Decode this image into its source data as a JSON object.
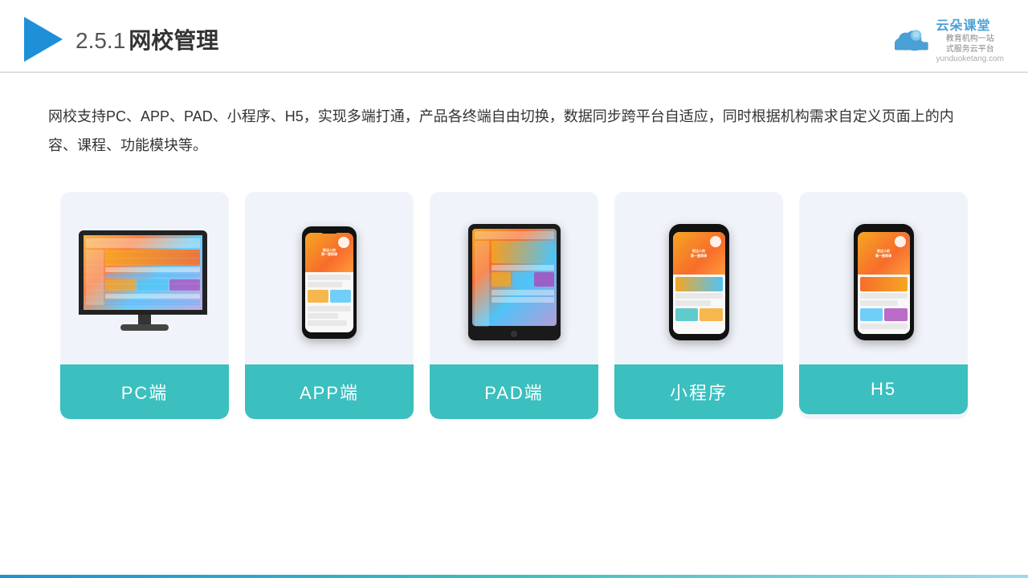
{
  "header": {
    "title": "2.5.1网校管理",
    "title_number": "2.5.1",
    "title_text": "网校管理",
    "brand_name": "云朵课堂",
    "brand_url": "yunduoketang.com",
    "brand_tagline": "教育机构一站\n式服务云平台"
  },
  "description": {
    "text": "网校支持PC、APP、PAD、小程序、H5，实现多端打通，产品各终端自由切换，数据同步跨平台自适应，同时根据机构需求自定义页面上的内容、课程、功能模块等。"
  },
  "cards": [
    {
      "label": "PC端",
      "type": "pc"
    },
    {
      "label": "APP端",
      "type": "phone"
    },
    {
      "label": "PAD端",
      "type": "tablet"
    },
    {
      "label": "小程序",
      "type": "miniprogram"
    },
    {
      "label": "H5",
      "type": "h5"
    }
  ],
  "colors": {
    "accent": "#3bbfbf",
    "accent2": "#1e90d8",
    "brand": "#4a9fd4",
    "header_line": "#ccc",
    "card_bg": "#eef2f8"
  }
}
